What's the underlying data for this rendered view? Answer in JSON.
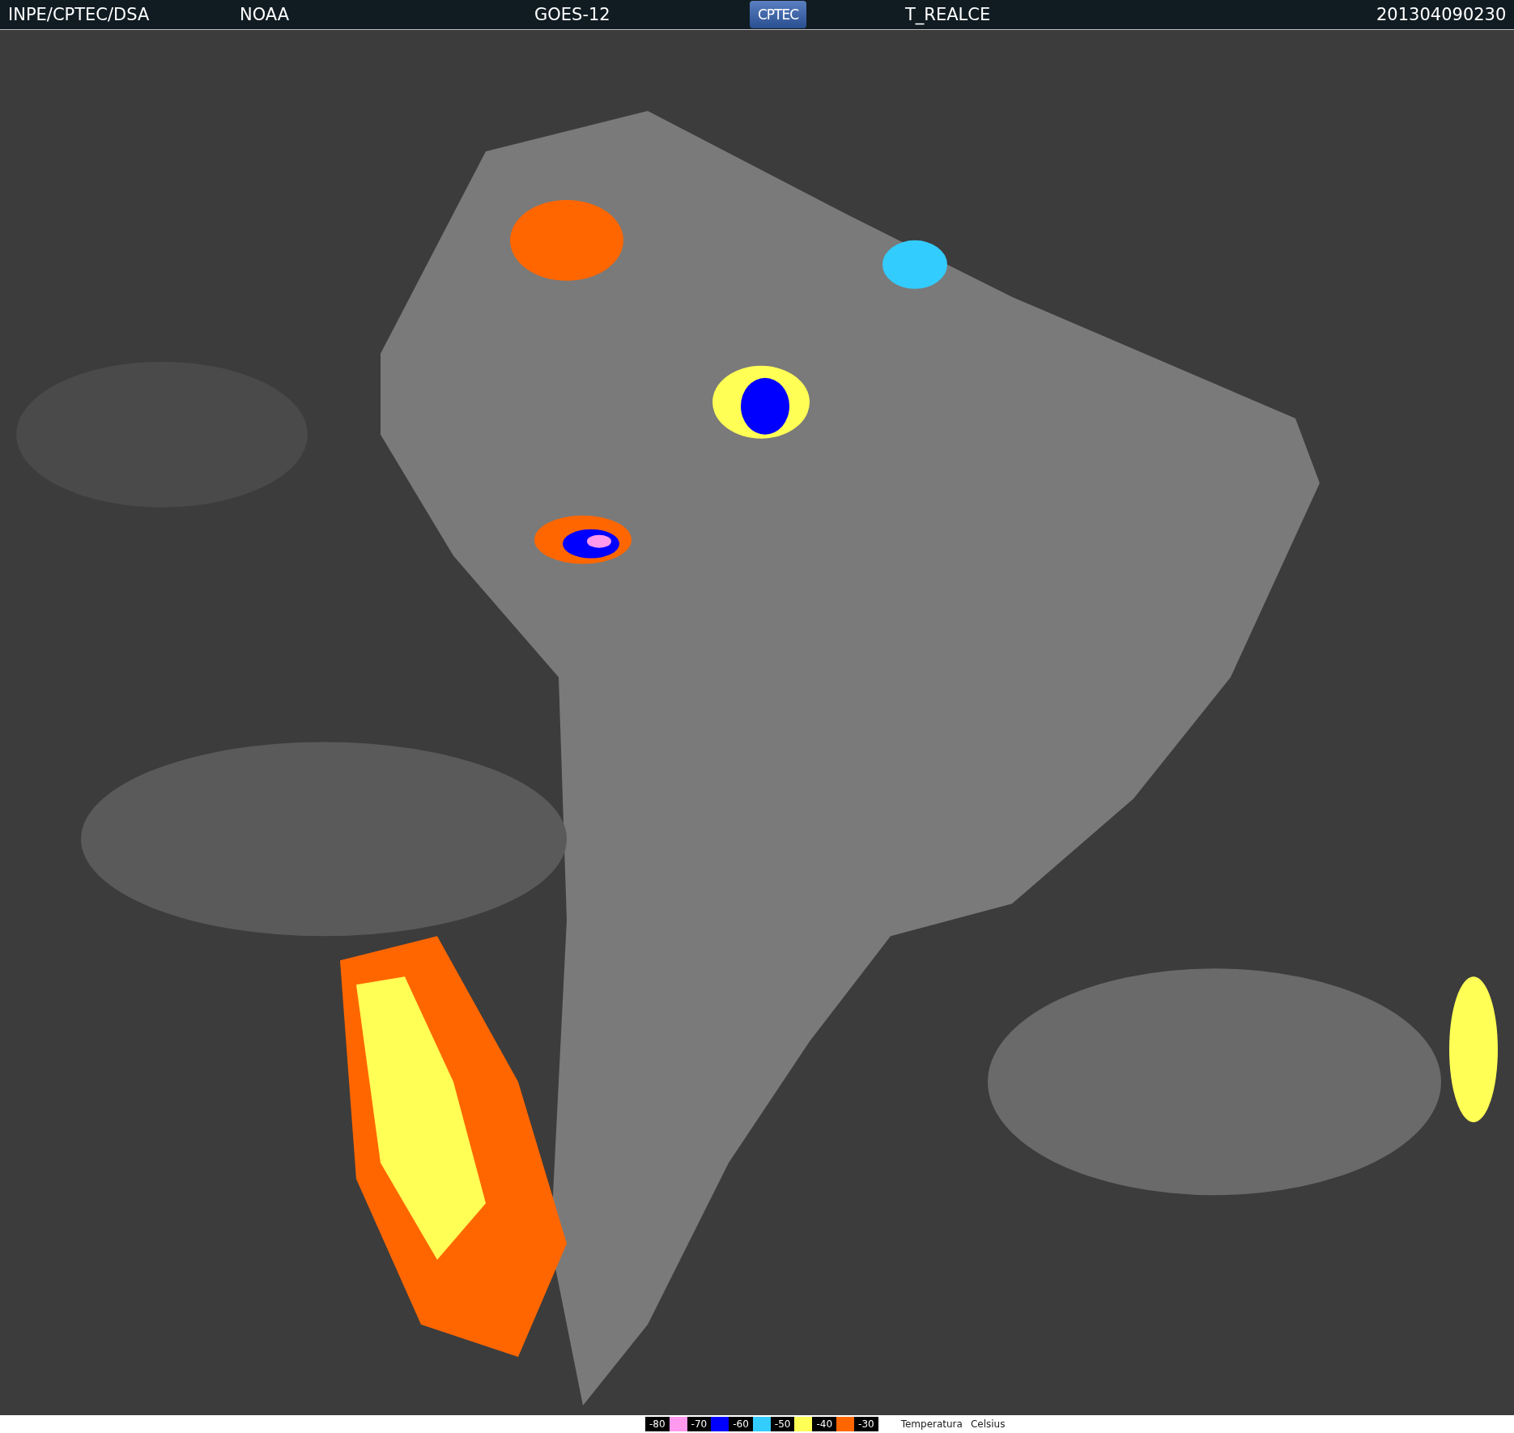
{
  "header": {
    "source": "INPE/CPTEC/DSA",
    "agency": "NOAA",
    "satellite": "GOES-12",
    "logo": "CPTEC",
    "product": "T_REALCE",
    "timestamp": "201304090230"
  },
  "legend": {
    "items": [
      {
        "label": "-80",
        "color": "#ff99ee"
      },
      {
        "label": "-70",
        "color": "#0000ff"
      },
      {
        "label": "-60",
        "color": "#33ccff"
      },
      {
        "label": "-50",
        "color": "#ffff55"
      },
      {
        "label": "-40",
        "color": "#ff6600"
      },
      {
        "label": "-30"
      }
    ],
    "caption": "Temperatura",
    "unit": "Celsius"
  }
}
